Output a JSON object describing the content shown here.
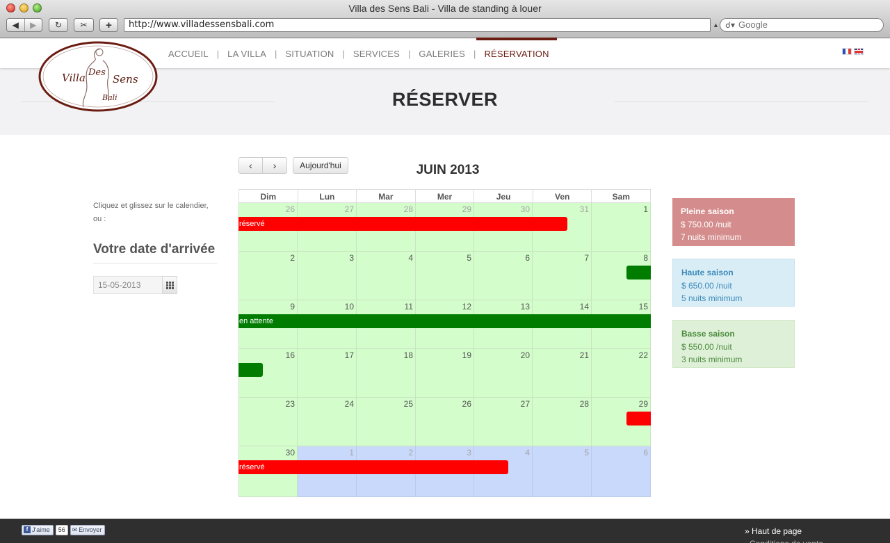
{
  "browser": {
    "window_title": "Villa des Sens Bali - Villa de standing à louer",
    "url": "http://www.villadessensbali.com",
    "search_placeholder": "Google"
  },
  "site": {
    "logo_text": {
      "villa": "Villa",
      "des": "Des",
      "sens": "Sens",
      "bali": "Bali"
    },
    "nav": [
      {
        "label": "ACCUEIL",
        "active": false
      },
      {
        "label": "LA VILLA",
        "active": false
      },
      {
        "label": "SITUATION",
        "active": false
      },
      {
        "label": "SERVICES",
        "active": false
      },
      {
        "label": "GALERIES",
        "active": false
      },
      {
        "label": "RÉSERVATION",
        "active": true
      }
    ],
    "nav_separator": "|",
    "languages": [
      "fr",
      "en"
    ],
    "accent_color": "#6b1d12"
  },
  "page_title": "RÉSERVER",
  "sidebar": {
    "hint": "Cliquez et glissez sur le calendier, ou :",
    "arrival_heading": "Votre date d'arrivée",
    "arrival_value": "15-05-2013",
    "calendar_icon": "calendar-grid-icon"
  },
  "calendar": {
    "prev_icon": "chevron-left-icon",
    "next_icon": "chevron-right-icon",
    "prev_label": "‹",
    "next_label": "›",
    "today_label": "Aujourd'hui",
    "month_title": "JUIN 2013",
    "weekdays": [
      "Dim",
      "Lun",
      "Mar",
      "Mer",
      "Jeu",
      "Ven",
      "Sam"
    ],
    "weeks": [
      [
        {
          "d": "26",
          "m": "prev"
        },
        {
          "d": "27",
          "m": "prev"
        },
        {
          "d": "28",
          "m": "prev"
        },
        {
          "d": "29",
          "m": "prev"
        },
        {
          "d": "30",
          "m": "prev"
        },
        {
          "d": "31",
          "m": "prev"
        },
        {
          "d": "1",
          "m": "cur"
        }
      ],
      [
        {
          "d": "2",
          "m": "cur"
        },
        {
          "d": "3",
          "m": "cur"
        },
        {
          "d": "4",
          "m": "cur"
        },
        {
          "d": "5",
          "m": "cur"
        },
        {
          "d": "6",
          "m": "cur"
        },
        {
          "d": "7",
          "m": "cur"
        },
        {
          "d": "8",
          "m": "cur"
        }
      ],
      [
        {
          "d": "9",
          "m": "cur"
        },
        {
          "d": "10",
          "m": "cur"
        },
        {
          "d": "11",
          "m": "cur"
        },
        {
          "d": "12",
          "m": "cur"
        },
        {
          "d": "13",
          "m": "cur"
        },
        {
          "d": "14",
          "m": "cur"
        },
        {
          "d": "15",
          "m": "cur"
        }
      ],
      [
        {
          "d": "16",
          "m": "cur"
        },
        {
          "d": "17",
          "m": "cur"
        },
        {
          "d": "18",
          "m": "cur"
        },
        {
          "d": "19",
          "m": "cur"
        },
        {
          "d": "20",
          "m": "cur"
        },
        {
          "d": "21",
          "m": "cur"
        },
        {
          "d": "22",
          "m": "cur"
        }
      ],
      [
        {
          "d": "23",
          "m": "cur"
        },
        {
          "d": "24",
          "m": "cur"
        },
        {
          "d": "25",
          "m": "cur"
        },
        {
          "d": "26",
          "m": "cur"
        },
        {
          "d": "27",
          "m": "cur"
        },
        {
          "d": "28",
          "m": "cur"
        },
        {
          "d": "29",
          "m": "cur"
        }
      ],
      [
        {
          "d": "30",
          "m": "cur"
        },
        {
          "d": "1",
          "m": "next"
        },
        {
          "d": "2",
          "m": "next"
        },
        {
          "d": "3",
          "m": "next"
        },
        {
          "d": "4",
          "m": "next"
        },
        {
          "d": "5",
          "m": "next"
        },
        {
          "d": "6",
          "m": "next"
        }
      ]
    ],
    "events": [
      {
        "label": "réservé",
        "status": "reserved",
        "start": "2013-05-26",
        "end": "2013-05-31"
      },
      {
        "label": "",
        "status": "pending",
        "start": "2013-06-08",
        "end": "2013-06-08"
      },
      {
        "label": "en attente",
        "status": "pending",
        "start": "2013-06-09",
        "end": "2013-06-15"
      },
      {
        "label": "",
        "status": "pending",
        "start": "2013-06-16",
        "end": "2013-06-16"
      },
      {
        "label": "",
        "status": "reserved",
        "start": "2013-06-29",
        "end": "2013-06-29"
      },
      {
        "label": "réservé",
        "status": "reserved",
        "start": "2013-06-30",
        "end": "2013-07-04"
      }
    ],
    "colors": {
      "reserved": "#ff0000",
      "pending": "#007c00",
      "current_month": "#d3fdcb",
      "next_month": "#c9d9fb"
    }
  },
  "seasons": [
    {
      "name": "Pleine saison",
      "price": "$ 750.00 /nuit",
      "minimum": "7 nuits minimum",
      "color": "#d48c8c"
    },
    {
      "name": "Haute saison",
      "price": "$ 650.00 /nuit",
      "minimum": "5 nuits minimum",
      "color": "#d9edf7"
    },
    {
      "name": "Basse saison",
      "price": "$ 550.00 /nuit",
      "minimum": "3 nuits minimum",
      "color": "#dff0d8"
    }
  ],
  "footer": {
    "like_label": "J'aime",
    "like_count": "56",
    "send_label": "Envoyer",
    "top_link": "» Haut de page",
    "conditions_link": "Conditions de vente"
  }
}
